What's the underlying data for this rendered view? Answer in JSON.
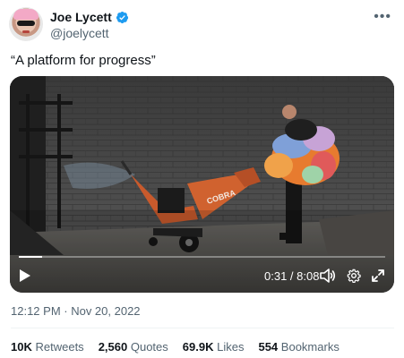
{
  "author": {
    "display_name": "Joe Lycett",
    "handle": "@joelycett",
    "verified": true
  },
  "tweet": {
    "text": "“A platform for progress”",
    "timestamp": "12:12 PM · Nov 20, 2022"
  },
  "video": {
    "time": "0:31 / 8:08",
    "progress": 0.064,
    "chipper_label": "COBRA"
  },
  "stats": [
    {
      "value": "10K",
      "label": "Retweets"
    },
    {
      "value": "2,560",
      "label": "Quotes"
    },
    {
      "value": "69.9K",
      "label": "Likes"
    },
    {
      "value": "554",
      "label": "Bookmarks"
    }
  ],
  "icons": {
    "verified": "verified-badge-icon",
    "more": "more-options-icon",
    "play": "play-icon",
    "volume": "volume-icon",
    "settings": "settings-icon",
    "fullscreen": "fullscreen-icon"
  },
  "colors": {
    "verified": "#1d9bf0",
    "text": "#0f1419",
    "muted": "#536471"
  }
}
